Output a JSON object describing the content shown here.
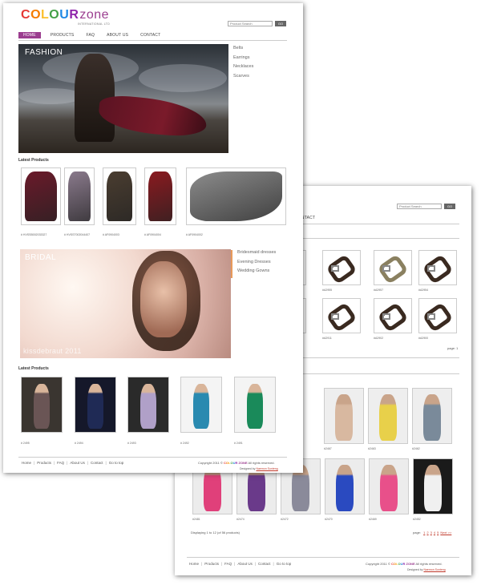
{
  "brand": {
    "name": "COLOUR ZONE",
    "letters": [
      {
        "ch": "C",
        "color": "#e53935"
      },
      {
        "ch": "O",
        "color": "#f57c00"
      },
      {
        "ch": "L",
        "color": "#fbc02d"
      },
      {
        "ch": "O",
        "color": "#43a047"
      },
      {
        "ch": "U",
        "color": "#1e88e5"
      },
      {
        "ch": "R",
        "color": "#8e24aa"
      }
    ],
    "zone": "zone",
    "zone_color": "#9b3d8f",
    "subtitle": "INTERNATIONAL LTD"
  },
  "search": {
    "placeholder": "Product Search",
    "go_label": "GO"
  },
  "nav": {
    "items": [
      "HOME",
      "PRODUCTS",
      "FAQ",
      "ABOUT US",
      "CONTACT"
    ],
    "active": "HOME",
    "back_visible": "CONTACT"
  },
  "fashion": {
    "label": "FASHION",
    "categories": [
      "Belts",
      "Earrings",
      "Necklaces",
      "Scarves"
    ]
  },
  "latest_title": "Latest Products",
  "scarves": [
    {
      "code": "# HVSSB002033327",
      "color": "#6a1a2a"
    },
    {
      "code": "# HVSST002044407",
      "color": "#8a7a8c"
    },
    {
      "code": "# AF0904003",
      "color": "#4a3d30"
    },
    {
      "code": "# AF0904004",
      "color": "#8a1a20"
    },
    {
      "code": "# AF0904002",
      "color": "#8c8c8c"
    }
  ],
  "bridal": {
    "label": "BRIDAL",
    "watermark": "kissdebraut 2011",
    "categories": [
      "Bridesmaid dresses",
      "Evening Dresses",
      "Wedding Gowns"
    ]
  },
  "dresses": [
    {
      "code": "# 2495",
      "color": "#6a5555"
    },
    {
      "code": "# 2494",
      "color": "#1f2a55"
    },
    {
      "code": "# 2493",
      "color": "#b0a0c8"
    },
    {
      "code": "# 2492",
      "color": "#2a8ab0"
    },
    {
      "code": "# 2491",
      "color": "#1a8a5a"
    }
  ],
  "footer": {
    "links": [
      "Home",
      "Products",
      "FAQ",
      "About Us",
      "Contact",
      "Go to top"
    ],
    "copyright_pre": "Copyright 2011 ©",
    "copyright_brand": "COLOUR ZONE",
    "copyright_post": "All rights reserved.",
    "designed_by": "Designed by",
    "designer": "Naemon Sunteng"
  },
  "back_page": {
    "belts": [
      {
        "code": "#A2955",
        "light": false
      },
      {
        "code": "#A2957",
        "light": true
      },
      {
        "code": "#A2954",
        "light": false
      },
      {
        "code": "#A2911",
        "light": false
      },
      {
        "code": "#A2902",
        "light": false
      },
      {
        "code": "#A2900",
        "light": false
      }
    ],
    "pager_label": "page: 1",
    "dresses_row1": [
      {
        "code": "#2467",
        "color": "#d8b8a0"
      },
      {
        "code": "#2463",
        "color": "#e8d04a"
      },
      {
        "code": "#2462",
        "color": "#7a8a9a"
      }
    ],
    "dresses_row2": [
      {
        "code": "#2481",
        "color": "#e0407a"
      },
      {
        "code": "#2474",
        "color": "#6a3a8a"
      },
      {
        "code": "#2472",
        "color": "#8a8a9a"
      },
      {
        "code": "#2470",
        "color": "#2a4ac0"
      },
      {
        "code": "#2469",
        "color": "#e8508a"
      },
      {
        "code": "#2452",
        "color": "#f0f0f0"
      }
    ],
    "display_count": "Displaying 1 to 12 (of 56 products)",
    "pager2_label": "page:",
    "pages": [
      "1",
      "2",
      "3",
      "4",
      "5",
      "Next >>"
    ]
  }
}
